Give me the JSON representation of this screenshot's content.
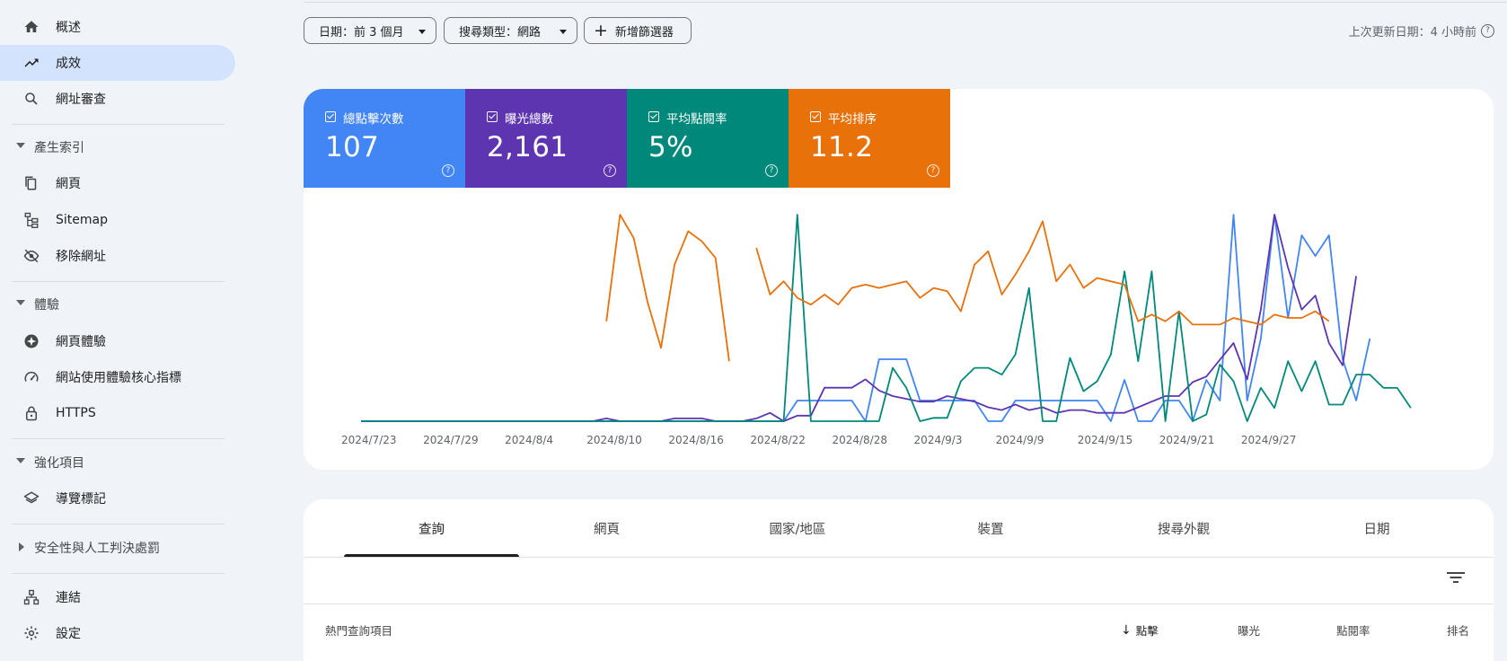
{
  "sidebar": {
    "items": [
      {
        "label": "概述",
        "icon": "home-icon"
      },
      {
        "label": "成效",
        "icon": "trending-up-icon",
        "active": true
      },
      {
        "label": "網址審查",
        "icon": "search-icon"
      }
    ],
    "sections": [
      {
        "label": "產生索引",
        "items": [
          {
            "label": "網頁",
            "icon": "pages-icon"
          },
          {
            "label": "Sitemap",
            "icon": "sitemap-icon"
          },
          {
            "label": "移除網址",
            "icon": "eye-off-icon"
          }
        ]
      },
      {
        "label": "體驗",
        "items": [
          {
            "label": "網頁體驗",
            "icon": "page-experience-icon"
          },
          {
            "label": "網站使用體驗核心指標",
            "icon": "speedometer-icon"
          },
          {
            "label": "HTTPS",
            "icon": "lock-icon"
          }
        ]
      },
      {
        "label": "強化項目",
        "items": [
          {
            "label": "導覽標記",
            "icon": "layers-icon"
          }
        ]
      },
      {
        "label": "安全性與人工判決處罰",
        "collapsed": true,
        "items": []
      }
    ],
    "footer_items": [
      {
        "label": "連結",
        "icon": "links-icon"
      },
      {
        "label": "設定",
        "icon": "gear-icon"
      }
    ]
  },
  "filters": {
    "date": "日期：前 3 個月",
    "search_type": "搜尋類型：網路",
    "add_filter": "新增篩選器",
    "last_updated": "上次更新日期：4 小時前"
  },
  "metrics": [
    {
      "label": "總點擊次數",
      "value": "107",
      "color": "#4285f4"
    },
    {
      "label": "曝光總數",
      "value": "2,161",
      "color": "#5e35b1"
    },
    {
      "label": "平均點閱率",
      "value": "5%",
      "color": "#00897b"
    },
    {
      "label": "平均排序",
      "value": "11.2",
      "color": "#e8710a"
    }
  ],
  "chart_data": {
    "type": "line",
    "x_tick_labels": [
      "2024/7/23",
      "2024/7/29",
      "2024/8/4",
      "2024/8/10",
      "2024/8/16",
      "2024/8/22",
      "2024/8/28",
      "2024/9/3",
      "2024/9/9",
      "2024/9/15",
      "2024/9/21",
      "2024/9/27"
    ],
    "x_start": "2024/7/23",
    "x_end": "2024/9/30",
    "grid": false,
    "legend": "none",
    "series": [
      {
        "name": "總點擊次數",
        "color": "#4285f4",
        "values": [
          0,
          0,
          0,
          0,
          0,
          0,
          0,
          0,
          0,
          0,
          0,
          0,
          0,
          0,
          0,
          0,
          0,
          0,
          0,
          0,
          0,
          0,
          0,
          0,
          0,
          0,
          0,
          0,
          0,
          0,
          0,
          0,
          1,
          1,
          1,
          1,
          1,
          0,
          3,
          3,
          3,
          1,
          1,
          1,
          1,
          1,
          0,
          0,
          1,
          1,
          1,
          1,
          1,
          1,
          1,
          0,
          2,
          0,
          0,
          1,
          1,
          0,
          2,
          1,
          10,
          1,
          4,
          10,
          5,
          9,
          8,
          9,
          3,
          1,
          4
        ]
      },
      {
        "name": "曝光總數",
        "color": "#5e35b1",
        "values": [
          0,
          0,
          0,
          0,
          0,
          0,
          0,
          0,
          0,
          0,
          0,
          0,
          0,
          0,
          0,
          0,
          0,
          0,
          1,
          0,
          0,
          0,
          0,
          1,
          1,
          1,
          0,
          0,
          0,
          1,
          3,
          0,
          2,
          2,
          12,
          12,
          12,
          15,
          11,
          9,
          8,
          7,
          7,
          9,
          8,
          7,
          5,
          4,
          6,
          4,
          5,
          3,
          4,
          4,
          3,
          3,
          3,
          5,
          7,
          9,
          9,
          14,
          16,
          22,
          28,
          15,
          40,
          74,
          55,
          40,
          45,
          28,
          20,
          52
        ]
      },
      {
        "name": "平均點閱率",
        "color": "#00897b",
        "values": [
          0,
          0,
          0,
          0,
          0,
          0,
          0,
          0,
          0,
          0,
          0,
          0,
          0,
          0,
          0,
          0,
          0,
          0,
          0,
          0,
          0,
          0,
          0,
          0,
          0,
          0,
          0,
          0,
          0,
          0,
          0,
          0,
          62,
          0,
          0,
          0,
          0,
          0,
          0,
          16,
          10,
          0,
          1,
          1,
          12,
          16,
          16,
          14,
          20,
          40,
          0,
          0,
          19,
          9,
          12,
          20,
          45,
          18,
          45,
          0,
          33,
          0,
          2,
          17,
          12,
          0,
          10,
          4,
          18,
          9,
          18,
          5,
          5,
          14,
          14,
          10,
          10,
          4
        ]
      },
      {
        "name": "平均排序",
        "color": "#e8710a",
        "values": [
          null,
          null,
          null,
          null,
          null,
          null,
          null,
          null,
          null,
          null,
          null,
          null,
          null,
          null,
          null,
          null,
          null,
          null,
          30,
          62,
          55,
          36,
          22,
          47,
          57,
          54,
          49,
          18,
          null,
          52,
          38,
          42,
          37,
          35,
          38,
          35,
          40,
          41,
          40,
          41,
          42,
          37,
          40,
          39,
          33,
          47,
          51,
          38,
          44,
          51,
          60,
          42,
          47,
          40,
          43,
          42,
          41,
          30,
          32,
          30,
          33,
          29,
          29,
          29,
          31,
          30,
          29,
          32,
          31,
          31,
          33,
          30
        ]
      }
    ]
  },
  "tabs": [
    "查詢",
    "網頁",
    "國家/地區",
    "裝置",
    "搜尋外觀",
    "日期"
  ],
  "table": {
    "columns": {
      "query": "熱門查詢項目",
      "clicks": "點擊",
      "impressions": "曝光",
      "ctr": "點閱率",
      "position": "排名"
    }
  }
}
